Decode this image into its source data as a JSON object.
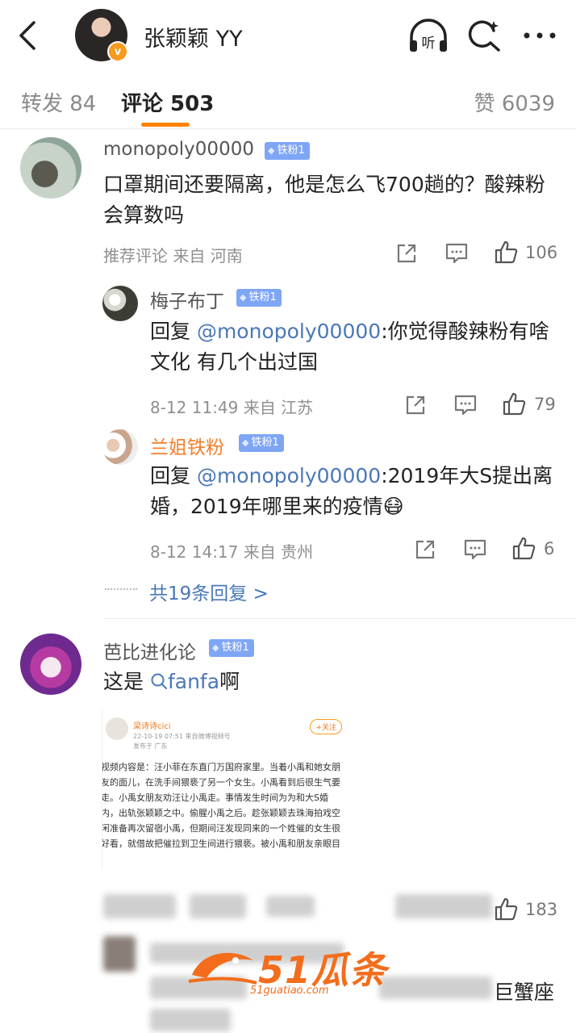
{
  "header": {
    "title": "张颖颖 YY",
    "verified_mark": "v",
    "icons": [
      "back-icon",
      "listen-icon",
      "search-icon",
      "more-icon"
    ]
  },
  "tabs": {
    "repost": "转发 84",
    "comments": "评论 503",
    "likes": "赞 6039",
    "active_color": "#ff8200"
  },
  "comments": [
    {
      "user": "monopoly00000",
      "badge": "铁粉1",
      "text": "口罩期间还要隔离，他是怎么飞700趟的？酸辣粉会算数吗",
      "meta": "推荐评论  来自 河南",
      "likes": "106",
      "replies": [
        {
          "user": "梅子布丁",
          "badge": "铁粉1",
          "reply_prefix": "回复 ",
          "mention": "@monopoly00000",
          "text": ":你觉得酸辣粉有啥文化 有几个出过国",
          "meta": "8-12 11:49  来自 江苏",
          "likes": "79"
        },
        {
          "user": "兰姐铁粉",
          "badge": "铁粉1",
          "reply_prefix": "回复 ",
          "mention": "@monopoly00000",
          "text": ":2019年大S提出离婚，2019年哪里来的疫情",
          "emoji": "😷",
          "meta": "8-12 14:17  来自 贵州",
          "likes": "6"
        }
      ],
      "more_replies": "共19条回复 >"
    },
    {
      "user": "芭比进化论",
      "badge": "铁粉1",
      "text_prefix": "这是",
      "search_term": "fanfa",
      "text_suffix": "啊",
      "embedded": {
        "name": "梁诗诗cici",
        "date": "22-10-19 07:51  来自微博视频号",
        "location": "发布于 广东",
        "follow": "+关注",
        "body": "视频内容是：汪小菲在东直门万国府家里。当着小禹和她女朋友的面儿，在洗手间猥亵了另一个女生。小禹看到后很生气要走。小禹女朋友劝汪让小禹走。事情发生时间为为和大S婚内，出轨张颖颖之中。偷腥小禹之后。趁张颖颖去珠海拍戏空闲准备再次留宿小禹，但期间汪发现同来的一个姓催的女生很好看，就借故把催拉到卫生间进行猥亵。被小禹和朋友亲眼目"
      },
      "likes": "183"
    }
  ],
  "partial_text": "巨蟹座",
  "watermark": {
    "text": "51瓜条",
    "url": "51guatiao.com"
  }
}
